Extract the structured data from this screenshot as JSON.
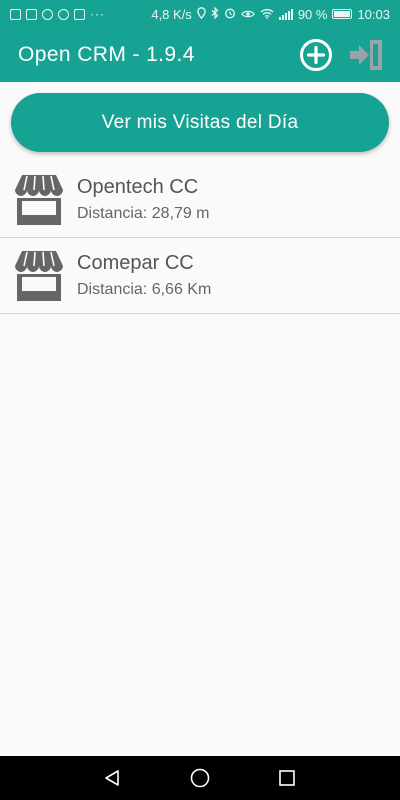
{
  "status_bar": {
    "network_speed": "4,8 K/s",
    "battery_percent": "90 %",
    "time": "10:03",
    "more_notifications": "···"
  },
  "app_bar": {
    "title": "Open CRM - 1.9.4"
  },
  "visits_button": {
    "label": "Ver mis Visitas del Día"
  },
  "stores": [
    {
      "name": "Opentech CC",
      "distance": "Distancia: 28,79 m"
    },
    {
      "name": "Comepar CC",
      "distance": "Distancia: 6,66 Km"
    }
  ],
  "colors": {
    "primary": "#17a394",
    "icon_gray": "#666666",
    "logout_gray": "#9aa3a8"
  },
  "icons": {
    "add": "add-circle-icon",
    "logout": "logout-door-icon",
    "store": "storefront-icon",
    "nav_back": "triangle-back-icon",
    "nav_home": "circle-home-icon",
    "nav_recents": "square-recents-icon"
  }
}
